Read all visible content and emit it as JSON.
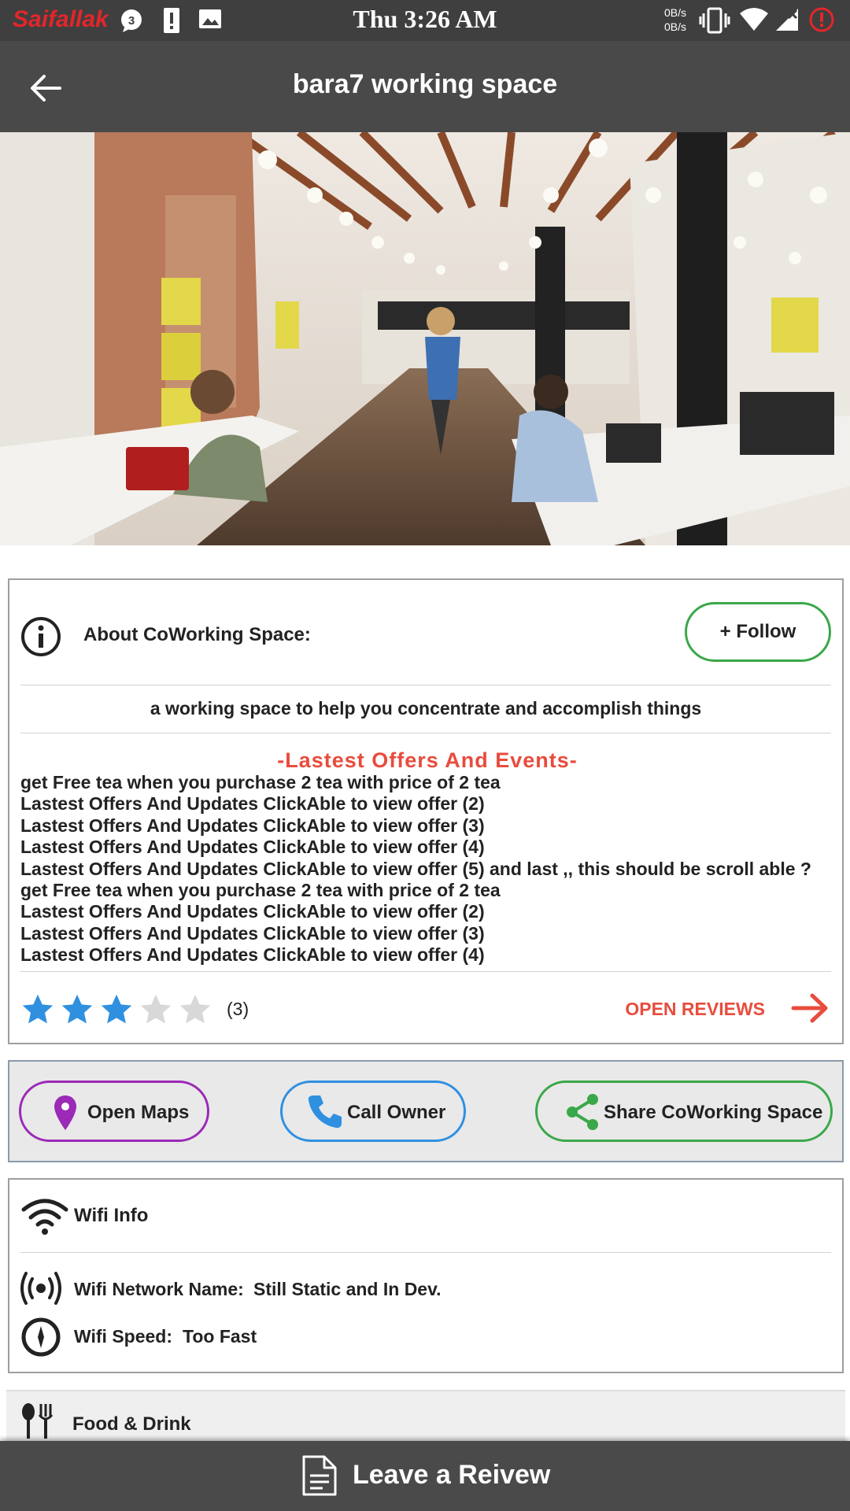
{
  "status_bar": {
    "carrier": "Saifallak",
    "notification_count": "3",
    "time": "Thu 3:26 AM",
    "net_up": "0B/s",
    "net_down": "0B/s",
    "icons": [
      "chat-bubble-icon",
      "alert-icon",
      "image-icon",
      "vibrate-icon",
      "wifi-icon",
      "signal-icon",
      "error-icon"
    ]
  },
  "app_bar": {
    "title": "bara7 working space",
    "back_icon": "arrow-left-icon"
  },
  "about": {
    "label": "About CoWorking Space:",
    "follow_label": "+ Follow",
    "description": "a working space to help you concentrate and accomplish things",
    "offers_title": "-Lastest Offers And Events-",
    "offers": [
      "get Free tea when you purchase 2 tea with price of 2 tea",
      "Lastest Offers And Updates ClickAble to view offer (2)",
      "Lastest Offers And Updates ClickAble to view offer (3)",
      "Lastest Offers And Updates ClickAble to view offer (4)",
      "Lastest Offers And Updates ClickAble to view offer (5) and last ,, this should be scroll able ?",
      "get Free tea when you purchase 2 tea with price of 2 tea",
      "Lastest Offers And Updates ClickAble to view offer (2)",
      "Lastest Offers And Updates ClickAble to view offer (3)",
      "Lastest Offers And Updates ClickAble to view offer (4)"
    ],
    "rating": {
      "value": 3,
      "max": 5,
      "count_label": "(3)"
    },
    "open_reviews_label": "OPEN REVIEWS"
  },
  "actions": {
    "maps_label": "Open Maps",
    "call_label": "Call Owner",
    "share_label": "Share CoWorking Space"
  },
  "wifi": {
    "title": "Wifi Info",
    "network_label": "Wifi Network Name:",
    "network_value": "Still Static and In Dev.",
    "speed_label": "Wifi Speed:",
    "speed_value": "Too Fast"
  },
  "food": {
    "label": "Food & Drink"
  },
  "footer": {
    "leave_review_label": "Leave a Reivew"
  },
  "colors": {
    "accent_red": "#e84c3d",
    "follow_green": "#3aa84a",
    "maps_purple": "#9b2ab7",
    "call_blue": "#2f90e0",
    "star_blue": "#2f90e0",
    "star_empty": "#d8d8d8"
  }
}
